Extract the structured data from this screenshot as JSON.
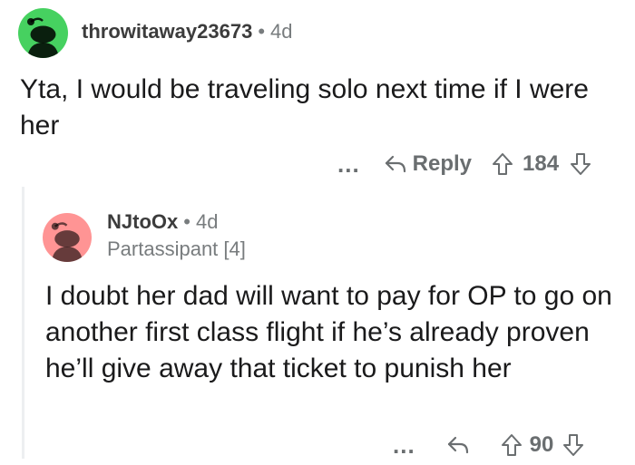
{
  "comment": {
    "username": "throwitaway23673",
    "time": "4d",
    "text": "Yta, I would be traveling solo next time if I were her",
    "reply_label": "Reply",
    "score": "184",
    "avatar_color": "#46d160"
  },
  "reply": {
    "username": "NJtoOx",
    "time": "4d",
    "flair": "Partassipant [4]",
    "text": "I doubt her dad will want to pay for OP to go on another first class flight if he’s already proven he’ll give away that ticket to punish her",
    "score": "90",
    "avatar_color": "#ff9494"
  },
  "separator": "•",
  "more_label": "..."
}
